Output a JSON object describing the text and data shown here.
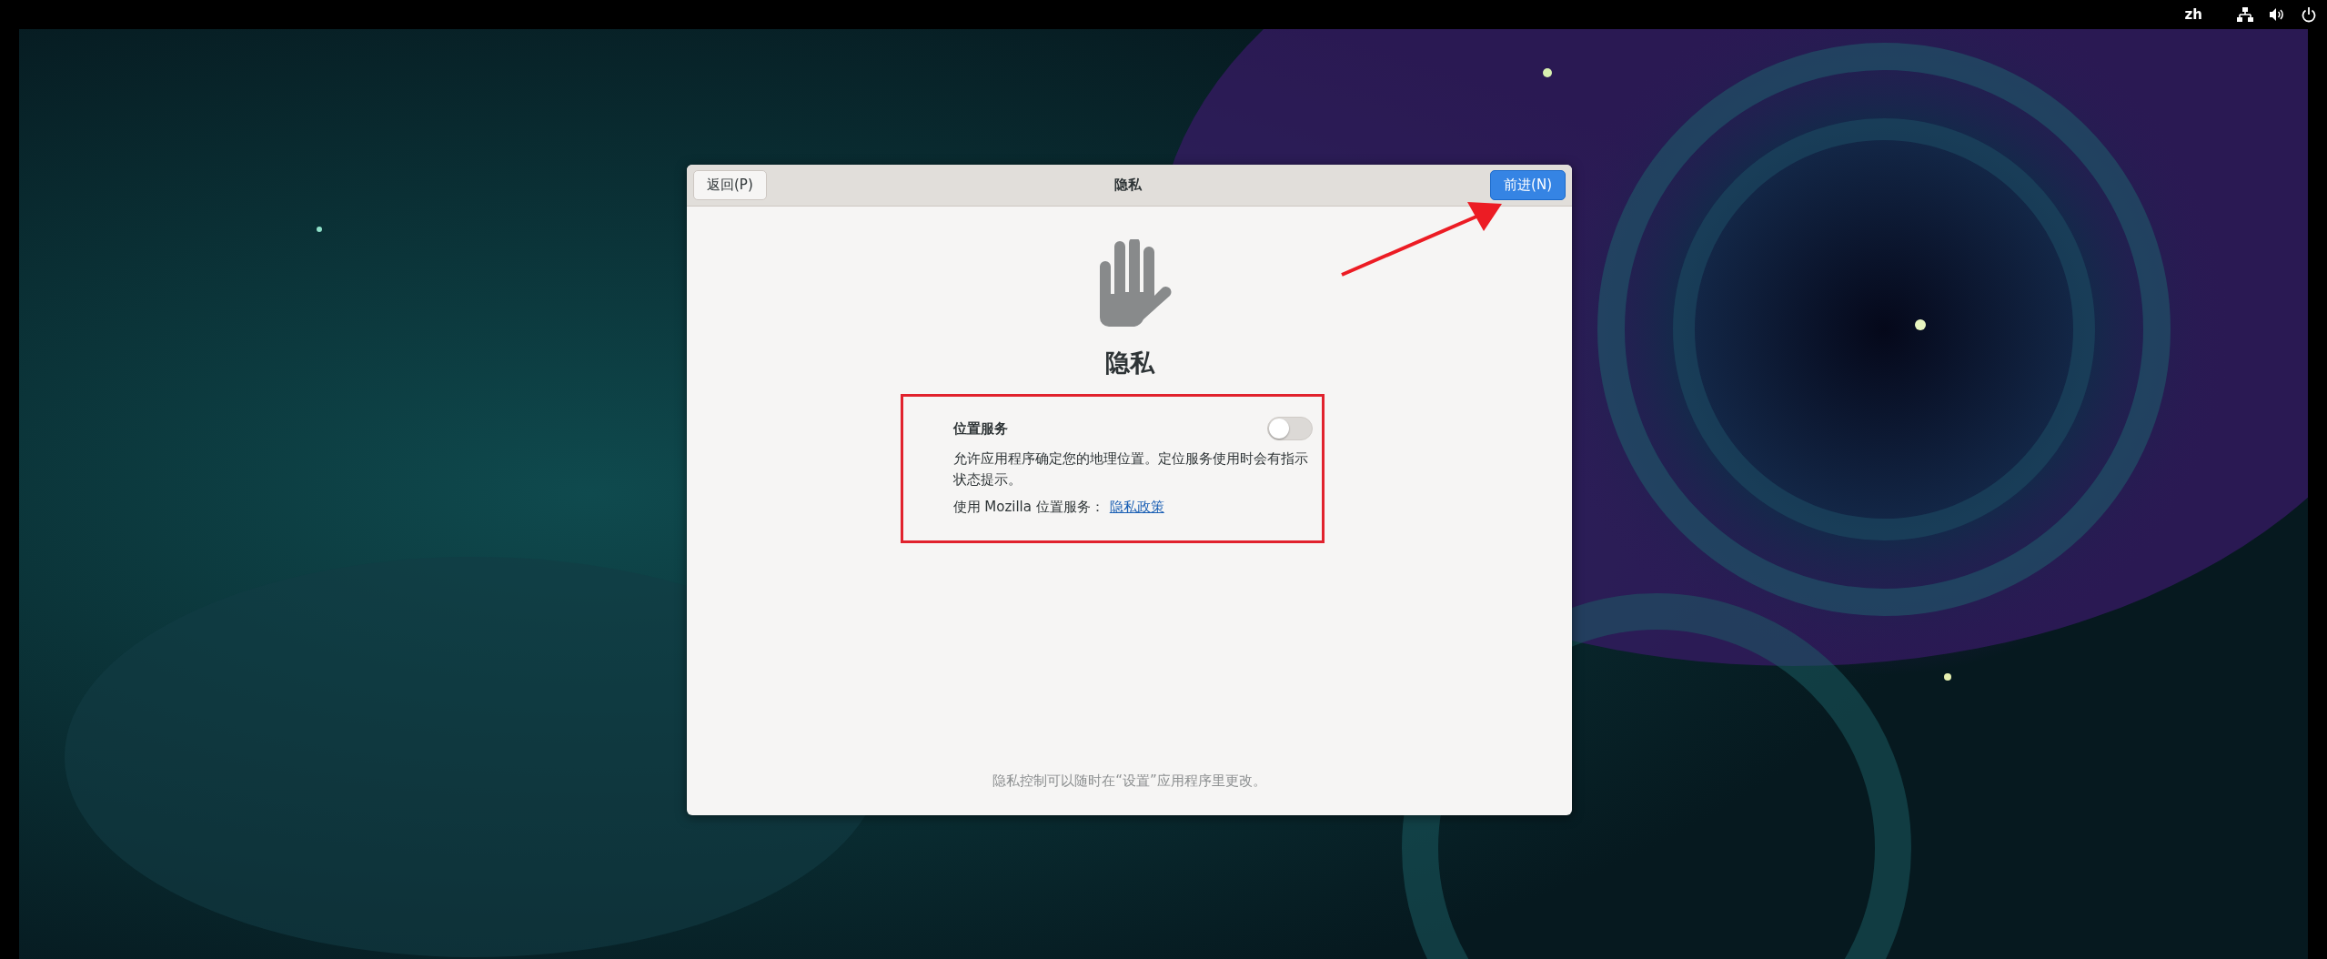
{
  "top_bar": {
    "language": "zh"
  },
  "dialog": {
    "back_button": "返回(P)",
    "title": "隐私",
    "next_button": "前进(N)",
    "heading": "隐私",
    "location_services": {
      "label": "位置服务",
      "on": false,
      "description": "允许应用程序确定您的地理位置。定位服务使用时会有指示状态提示。",
      "policy_prefix": "使用 Mozilla 位置服务：",
      "policy_link": "隐私政策"
    },
    "footer": "隐私控制可以随时在“设置”应用程序里更改。"
  }
}
